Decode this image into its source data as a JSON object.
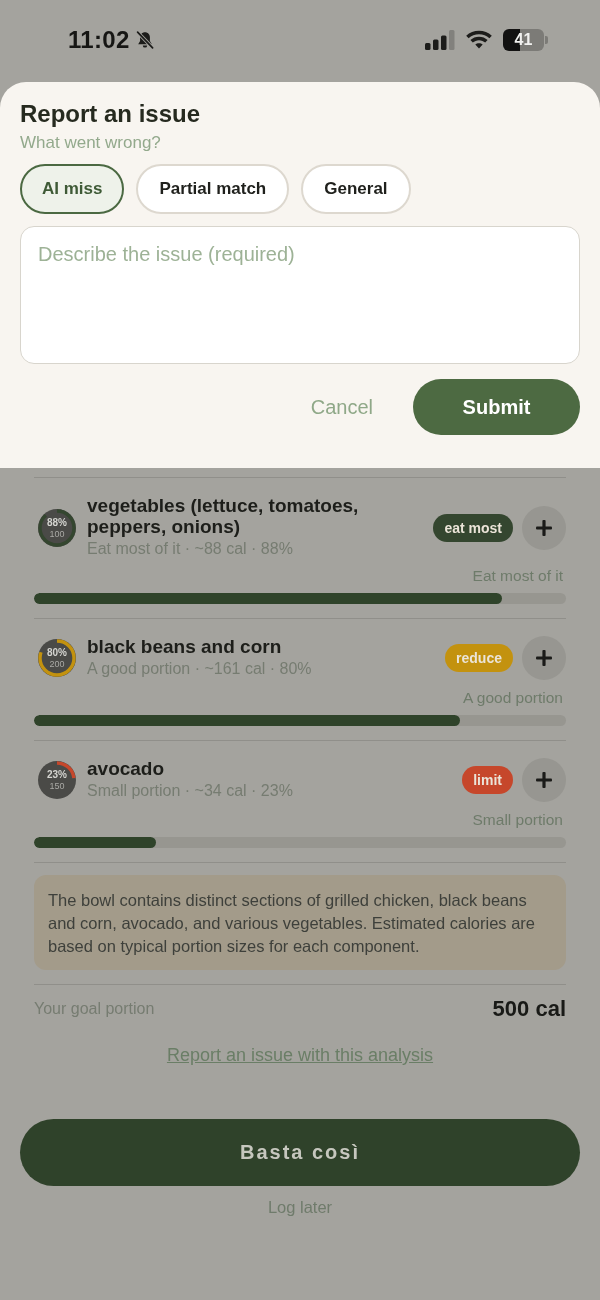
{
  "status_bar": {
    "time": "11:02",
    "battery": "41"
  },
  "sheet": {
    "title": "Report an issue",
    "subtitle": "What went wrong?",
    "options": [
      {
        "label": "AI miss",
        "selected": true
      },
      {
        "label": "Partial match",
        "selected": false
      },
      {
        "label": "General",
        "selected": false
      }
    ],
    "description": {
      "placeholder": "Describe the issue (required)"
    },
    "buttons": [
      {
        "label": "Cancel",
        "kind": "text"
      },
      {
        "label": "Submit",
        "kind": "primary"
      }
    ]
  },
  "items": [
    {
      "name": "vegetables (lettuce, tomatoes, peppers, onions)",
      "detail": "Eat most of it · ~88 cal · 88%",
      "ring_percent": "88%",
      "ring_base": "100",
      "badge": "eat most",
      "color": "#34462f",
      "portion_label": "Eat most of it",
      "level": 0.88
    },
    {
      "name": "black beans and corn",
      "detail": "A good portion · ~161 cal · 80%",
      "ring_percent": "80%",
      "ring_base": "200",
      "badge": "reduce",
      "color": "#c3920f",
      "portion_label": "A good portion",
      "level": 0.8
    },
    {
      "name": "avocado",
      "detail": "Small portion · ~34 cal · 23%",
      "ring_percent": "23%",
      "ring_base": "150",
      "badge": "limit",
      "color": "#c6472b",
      "portion_label": "Small portion",
      "level": 0.23
    }
  ],
  "summary": "The bowl contains distinct sections of grilled chicken, black beans and corn, avocado, and various vegetables. Estimated calories are based on typical portion sizes for each component.",
  "goal": {
    "label": "Your goal portion",
    "value": "500 cal"
  },
  "report_link": "Report an issue with this analysis",
  "primary_button": "Basta così",
  "secondary_link": "Log later"
}
